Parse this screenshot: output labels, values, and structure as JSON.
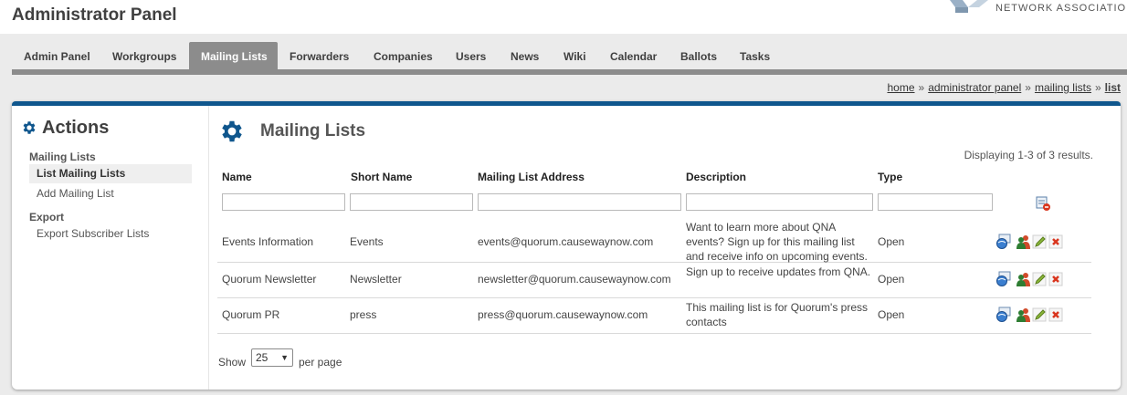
{
  "header": {
    "title": "Administrator Panel",
    "org_name": "NETWORK ASSOCIATION"
  },
  "nav": {
    "tabs": [
      {
        "label": "Admin Panel"
      },
      {
        "label": "Workgroups"
      },
      {
        "label": "Mailing Lists",
        "active": true
      },
      {
        "label": "Forwarders"
      },
      {
        "label": "Companies"
      },
      {
        "label": "Users"
      },
      {
        "label": "News"
      },
      {
        "label": "Wiki"
      },
      {
        "label": "Calendar"
      },
      {
        "label": "Ballots"
      },
      {
        "label": "Tasks"
      }
    ]
  },
  "breadcrumb": {
    "items": [
      "home",
      "administrator panel",
      "mailing lists",
      "list"
    ],
    "separator": "»"
  },
  "sidebar": {
    "title": "Actions",
    "sections": [
      {
        "heading": "Mailing Lists",
        "items": [
          "List Mailing Lists",
          "Add Mailing List"
        ]
      },
      {
        "heading": "Export",
        "items": [
          "Export Subscriber Lists"
        ]
      }
    ]
  },
  "main": {
    "title": "Mailing Lists",
    "summary": "Displaying 1-3 of 3 results.",
    "columns": [
      "Name",
      "Short Name",
      "Mailing List Address",
      "Description",
      "Type"
    ],
    "rows": [
      {
        "name": "Events Information",
        "short_name": "Events",
        "address": "events@quorum.causewaynow.com",
        "description": "Want to learn more about QNA events? Sign up for this mailing list and receive info on upcoming events.",
        "type": "Open"
      },
      {
        "name": "Quorum Newsletter",
        "short_name": "Newsletter",
        "address": "newsletter@quorum.causewaynow.com",
        "description": "Sign up to receive updates from QNA.",
        "type": "Open"
      },
      {
        "name": "Quorum PR",
        "short_name": "press",
        "address": "press@quorum.causewaynow.com",
        "description": "This mailing list is for Quorum's press contacts",
        "type": "Open"
      }
    ],
    "row_action_icons": [
      "view-subscribers-icon",
      "manage-users-icon",
      "edit-pencil-icon",
      "delete-x-icon"
    ],
    "pager": {
      "show_label": "Show",
      "per_page_value": "25",
      "per_page_label": "per page"
    }
  },
  "colors": {
    "accent": "#0f568d",
    "tab_active": "#8c8c8c",
    "delete": "#d9361f"
  }
}
